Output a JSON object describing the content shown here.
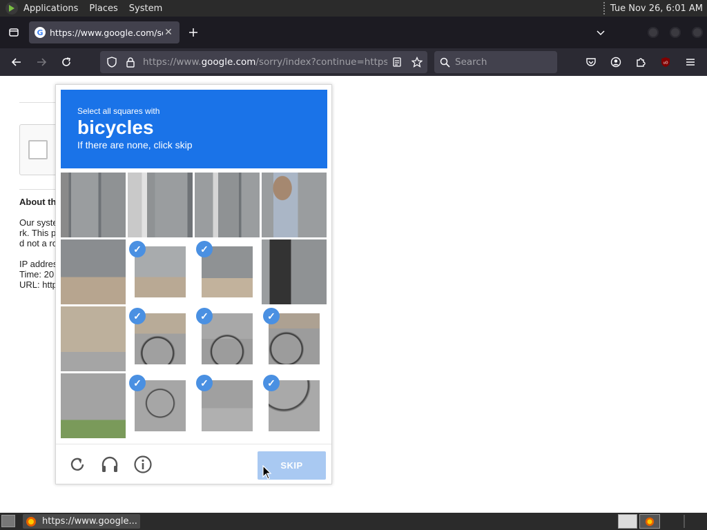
{
  "top_panel": {
    "menu_applications": "Applications",
    "menu_places": "Places",
    "menu_system": "System",
    "clock": "Tue Nov 26,  6:01 AM"
  },
  "tab_bar": {
    "tab_title": "https://www.google.com/so",
    "favicon_letter": "G"
  },
  "nav_bar": {
    "url_prefix": "https://www.",
    "url_host": "google.com",
    "url_rest": "/sorry/index?continue=https://w",
    "search_placeholder": "Search"
  },
  "page": {
    "about_heading": "About th",
    "text_line1": "Our syste",
    "text_line2": "rk. This p",
    "text_line3": "d not a ro",
    "ip_label": "IP addres",
    "time_label": "Time: 20",
    "url_label": "URL: http"
  },
  "captcha": {
    "instruction_line1": "Select all squares with",
    "target_word": "bicycles",
    "instruction_line3": "If there are none, click skip",
    "skip_label": "SKIP",
    "tiles_selected": [
      false,
      false,
      false,
      false,
      false,
      true,
      true,
      false,
      false,
      true,
      true,
      true,
      false,
      true,
      true,
      true
    ]
  },
  "bottom_panel": {
    "taskbar_label": "https://www.google..."
  },
  "colors": {
    "captcha_header": "#1a73e8",
    "check_badge": "#4a90e2",
    "skip_disabled": "#a9c9f2",
    "browser_chrome": "#2b2a33"
  },
  "icons": {
    "reload": "reload-icon",
    "audio": "headphones-icon",
    "info": "info-icon"
  }
}
